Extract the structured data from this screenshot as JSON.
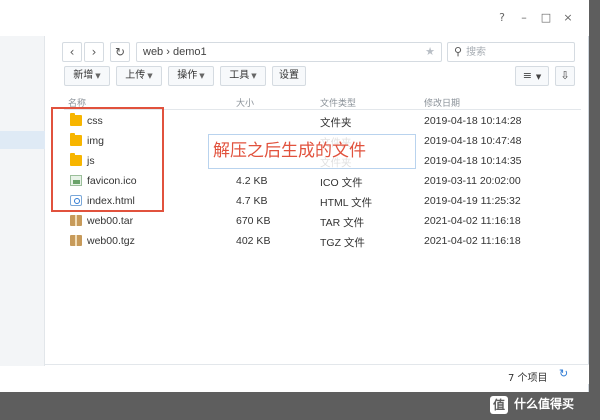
{
  "window": {
    "help_icon": "?",
    "minimize_icon": "–",
    "maximize_icon": "□",
    "close_icon": "×"
  },
  "nav": {
    "back_icon": "‹",
    "forward_icon": "›",
    "refresh_icon": "↻",
    "path": "web › demo1",
    "star_icon": "★",
    "search_placeholder": "搜索",
    "search_icon": "⚲"
  },
  "toolbar": {
    "new_label": "新增",
    "upload_label": "上传",
    "action_label": "操作",
    "tools_label": "工具",
    "settings_label": "设置",
    "view_icon": "≡",
    "sort_icon": "⇩"
  },
  "table": {
    "headers": {
      "name": "名称",
      "size": "大小",
      "type": "文件类型",
      "modified": "修改日期"
    },
    "rows": [
      {
        "name": "css",
        "size": "",
        "type": "文件夹",
        "modified": "2019-04-18 10:14:28",
        "icon": "folder"
      },
      {
        "name": "img",
        "size": "",
        "type": "文件夹",
        "modified": "2019-04-18 10:47:48",
        "icon": "folder"
      },
      {
        "name": "js",
        "size": "",
        "type": "文件夹",
        "modified": "2019-04-18 10:14:35",
        "icon": "folder"
      },
      {
        "name": "favicon.ico",
        "size": "4.2 KB",
        "type": "ICO 文件",
        "modified": "2019-03-11 20:02:00",
        "icon": "image"
      },
      {
        "name": "index.html",
        "size": "4.7 KB",
        "type": "HTML 文件",
        "modified": "2019-04-19 11:25:32",
        "icon": "html"
      },
      {
        "name": "web00.tar",
        "size": "670 KB",
        "type": "TAR 文件",
        "modified": "2021-04-02 11:16:18",
        "icon": "archive"
      },
      {
        "name": "web00.tgz",
        "size": "402 KB",
        "type": "TGZ 文件",
        "modified": "2021-04-02 11:16:18",
        "icon": "archive"
      }
    ]
  },
  "annotation": {
    "text": "解压之后生成的文件",
    "color": "#e1523d"
  },
  "status": {
    "count": "7 个项目",
    "refresh_icon": "↻"
  },
  "watermark": {
    "logo": "值",
    "text": "什么值得买"
  }
}
